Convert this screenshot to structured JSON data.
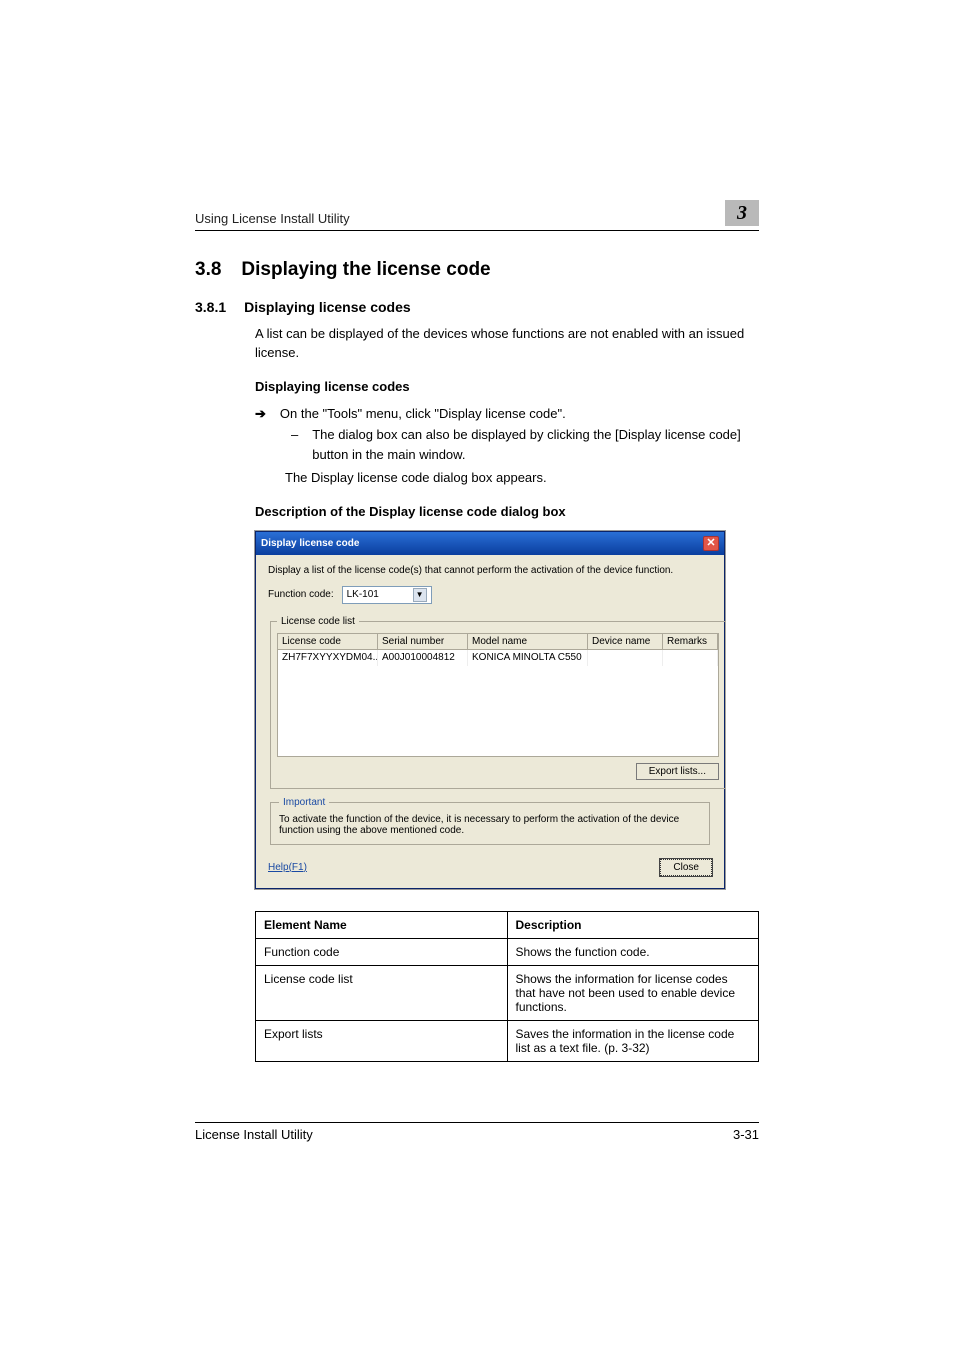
{
  "header": {
    "running_title": "Using License Install Utility",
    "chapter_num": "3"
  },
  "section": {
    "num": "3.8",
    "title": "Displaying the license code"
  },
  "subsection": {
    "num": "3.8.1",
    "title": "Displaying license codes"
  },
  "intro": "A list can be displayed of the devices whose functions are not enabled with an issued license.",
  "proc_heading": "Displaying license codes",
  "proc": {
    "main": "On the \"Tools\" menu, click \"Display license code\".",
    "sub": "The dialog box can also be displayed by clicking the [Display license code] button in the main window.",
    "result": "The Display license code dialog box appears."
  },
  "desc_heading": "Description of the Display license code dialog box",
  "dialog": {
    "title": "Display license code",
    "close_glyph": "✕",
    "description": "Display a list of the license code(s) that cannot perform the activation of the device function.",
    "function_label": "Function code:",
    "function_value": "LK-101",
    "caret": "▼",
    "list_legend": "License code list",
    "cols": {
      "c1": "License code",
      "c2": "Serial number",
      "c3": "Model name",
      "c4": "Device name",
      "c5": "Remarks"
    },
    "row": {
      "license": "ZH7F7XYYXYDM04...",
      "serial": "A00J010004812",
      "model": "KONICA MINOLTA C550",
      "device": "",
      "remarks": ""
    },
    "export_btn": "Export lists...",
    "important_legend": "Important",
    "important_text": "To activate the function of the device, it is necessary to perform the activation of the device function using the above mentioned code.",
    "help": "Help(F1)",
    "close_btn": "Close"
  },
  "table": {
    "h1": "Element Name",
    "h2": "Description",
    "rows": [
      {
        "name": "Function code",
        "desc": "Shows the function code."
      },
      {
        "name": "License code list",
        "desc": "Shows the information for license codes that have not been used to enable device functions."
      },
      {
        "name": "Export lists",
        "desc": "Saves the information in the license code list as a text file. (p. 3-32)"
      }
    ]
  },
  "footer": {
    "doc": "License Install Utility",
    "page": "3-31"
  }
}
